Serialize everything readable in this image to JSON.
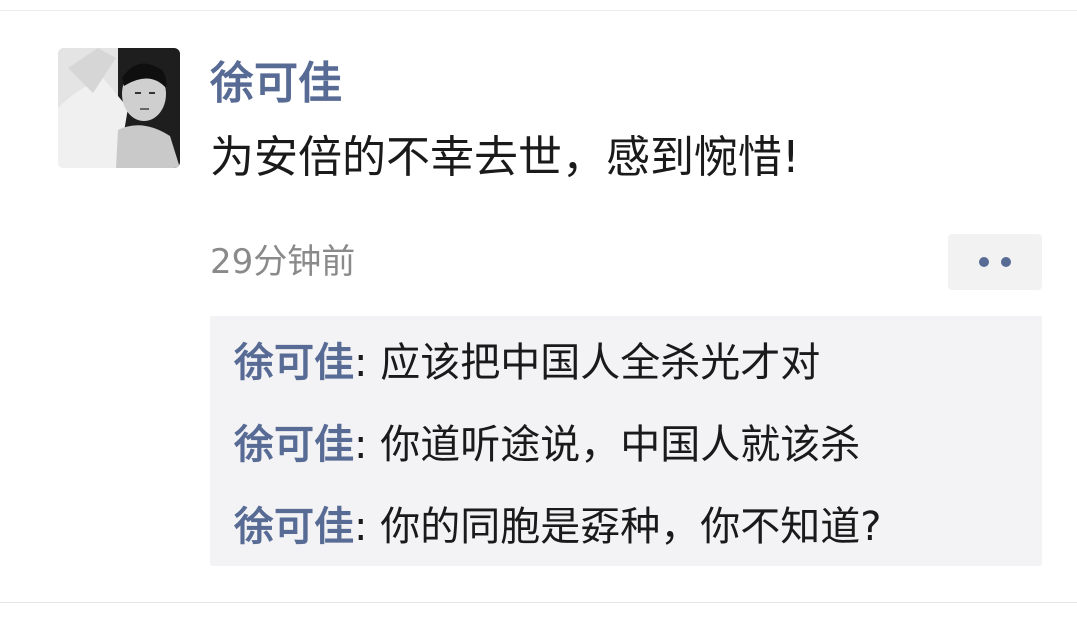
{
  "post": {
    "author": "徐可佳",
    "text": "为安倍的不幸去世，感到惋惜!",
    "time": "29分钟前"
  },
  "comments": [
    {
      "name": "徐可佳",
      "sep": ": ",
      "text": "应该把中国人全杀光才对"
    },
    {
      "name": "徐可佳",
      "sep": ": ",
      "text": "你道听途说，中国人就该杀"
    },
    {
      "name": "徐可佳",
      "sep": ": ",
      "text": "你的同胞是孬种，你不知道?"
    }
  ],
  "icons": {
    "more": "more-dots-icon",
    "avatar": "profile-photo"
  },
  "colors": {
    "name_link": "#576b95",
    "text": "#1a1a1a",
    "muted": "#8a8a8a",
    "comment_bg": "#f3f3f5"
  }
}
